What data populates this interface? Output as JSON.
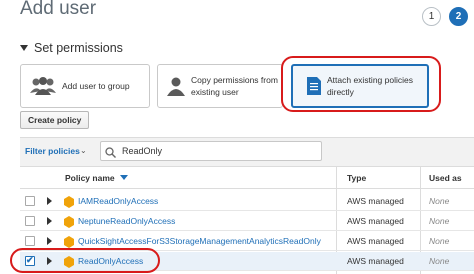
{
  "header": {
    "title": "Add user",
    "steps": [
      "1",
      "2"
    ]
  },
  "section": {
    "title": "Set permissions"
  },
  "options": [
    {
      "label": "Add user to group",
      "icon": "group-icon"
    },
    {
      "label": "Copy permissions from existing user",
      "icon": "user-icon"
    },
    {
      "label": "Attach existing policies directly",
      "icon": "document-icon"
    }
  ],
  "toolbar": {
    "create_policy": "Create policy"
  },
  "filter": {
    "label": "Filter policies",
    "search_value": "ReadOnly"
  },
  "table": {
    "headers": {
      "name": "Policy name",
      "type": "Type",
      "used": "Used as"
    },
    "rows": [
      {
        "name": "IAMReadOnlyAccess",
        "type": "AWS managed",
        "used": "None",
        "checked": false
      },
      {
        "name": "NeptuneReadOnlyAccess",
        "type": "AWS managed",
        "used": "None",
        "checked": false
      },
      {
        "name": "QuickSightAccessForS3StorageManagementAnalyticsReadOnly",
        "type": "AWS managed",
        "used": "None",
        "checked": false
      },
      {
        "name": "ReadOnlyAccess",
        "type": "AWS managed",
        "used": "None",
        "checked": true
      }
    ]
  },
  "colors": {
    "accent": "#1f6fb7",
    "highlight_ring": "#d81b1b",
    "policy_icon": "#f0a30a"
  }
}
